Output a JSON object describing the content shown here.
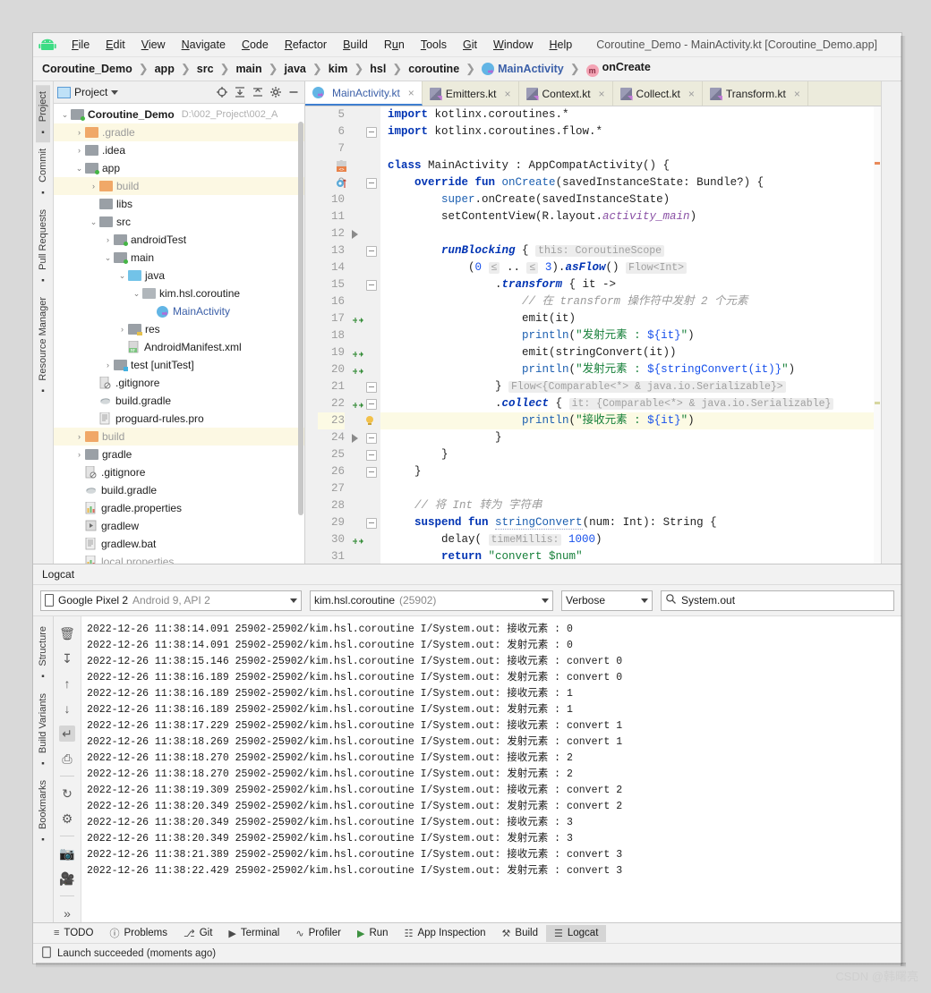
{
  "window": {
    "title": "Coroutine_Demo - MainActivity.kt [Coroutine_Demo.app]",
    "logo": "android-logo-icon"
  },
  "menubar": [
    {
      "label": "File",
      "accel": "F"
    },
    {
      "label": "Edit",
      "accel": "E"
    },
    {
      "label": "View",
      "accel": "V"
    },
    {
      "label": "Navigate",
      "accel": "N"
    },
    {
      "label": "Code",
      "accel": "C"
    },
    {
      "label": "Refactor",
      "accel": "R"
    },
    {
      "label": "Build",
      "accel": "B"
    },
    {
      "label": "Run",
      "accel": "u"
    },
    {
      "label": "Tools",
      "accel": "T"
    },
    {
      "label": "Git",
      "accel": "G"
    },
    {
      "label": "Window",
      "accel": "W"
    },
    {
      "label": "Help",
      "accel": "H"
    }
  ],
  "breadcrumb": [
    {
      "label": "Coroutine_Demo",
      "icon": ""
    },
    {
      "label": "app",
      "icon": ""
    },
    {
      "label": "src",
      "icon": ""
    },
    {
      "label": "main",
      "icon": ""
    },
    {
      "label": "java",
      "icon": ""
    },
    {
      "label": "kim",
      "icon": ""
    },
    {
      "label": "hsl",
      "icon": ""
    },
    {
      "label": "coroutine",
      "icon": ""
    },
    {
      "label": "MainActivity",
      "icon": "kotlin-class-icon"
    },
    {
      "label": "onCreate",
      "icon": "method-icon"
    }
  ],
  "left_strip": [
    {
      "label": "Project",
      "selected": true,
      "icon": "project-icon"
    },
    {
      "label": "Commit",
      "selected": false,
      "icon": "commit-icon"
    },
    {
      "label": "Pull Requests",
      "selected": false,
      "icon": "pull-request-icon"
    },
    {
      "label": "Resource Manager",
      "selected": false,
      "icon": "resource-icon"
    }
  ],
  "left_strip_bottom": [
    {
      "label": "Structure",
      "icon": "structure-icon"
    },
    {
      "label": "Build Variants",
      "icon": "build-variants-icon"
    },
    {
      "label": "Bookmarks",
      "icon": "bookmark-icon"
    }
  ],
  "project_panel": {
    "title": "Project",
    "project_name": "Coroutine_Demo",
    "project_path": "D:\\002_Project\\002_A",
    "toolbar_icons": [
      "target-icon",
      "collapse-icon",
      "expand-icon",
      "gear-icon",
      "minimize-icon"
    ],
    "tree": [
      {
        "depth": 0,
        "label": "Coroutine_Demo",
        "arrow": "down",
        "kind": "folder-grey-dot",
        "bold": true,
        "path": "D:\\002_Project\\002_A"
      },
      {
        "depth": 1,
        "label": ".gradle",
        "arrow": "right",
        "kind": "folder-orange",
        "highlight": true,
        "muted": true
      },
      {
        "depth": 1,
        "label": ".idea",
        "arrow": "right",
        "kind": "folder-grey"
      },
      {
        "depth": 1,
        "label": "app",
        "arrow": "down",
        "kind": "folder-grey-dot"
      },
      {
        "depth": 2,
        "label": "build",
        "arrow": "right",
        "kind": "folder-orange",
        "highlight": true,
        "muted": true
      },
      {
        "depth": 2,
        "label": "libs",
        "arrow": "none",
        "kind": "folder-grey"
      },
      {
        "depth": 2,
        "label": "src",
        "arrow": "down",
        "kind": "folder-grey"
      },
      {
        "depth": 3,
        "label": "androidTest",
        "arrow": "right",
        "kind": "folder-grey-dot"
      },
      {
        "depth": 3,
        "label": "main",
        "arrow": "down",
        "kind": "folder-grey-dot"
      },
      {
        "depth": 4,
        "label": "java",
        "arrow": "down",
        "kind": "folder-blue"
      },
      {
        "depth": 5,
        "label": "kim.hsl.coroutine",
        "arrow": "down",
        "kind": "package-icon"
      },
      {
        "depth": 6,
        "label": "MainActivity",
        "arrow": "none",
        "kind": "kotlin-class-icon",
        "link": true
      },
      {
        "depth": 4,
        "label": "res",
        "arrow": "right",
        "kind": "folder-res"
      },
      {
        "depth": 4,
        "label": "AndroidManifest.xml",
        "arrow": "none",
        "kind": "manifest-icon"
      },
      {
        "depth": 3,
        "label": "test [unitTest]",
        "arrow": "right",
        "kind": "folder-grey-sq"
      },
      {
        "depth": 2,
        "label": ".gitignore",
        "arrow": "none",
        "kind": "gitignore-icon"
      },
      {
        "depth": 2,
        "label": "build.gradle",
        "arrow": "none",
        "kind": "gradle-icon"
      },
      {
        "depth": 2,
        "label": "proguard-rules.pro",
        "arrow": "none",
        "kind": "text-file-icon"
      },
      {
        "depth": 1,
        "label": "build",
        "arrow": "right",
        "kind": "folder-orange",
        "highlight": true,
        "muted": true
      },
      {
        "depth": 1,
        "label": "gradle",
        "arrow": "right",
        "kind": "folder-grey"
      },
      {
        "depth": 1,
        "label": ".gitignore",
        "arrow": "none",
        "kind": "gitignore-icon"
      },
      {
        "depth": 1,
        "label": "build.gradle",
        "arrow": "none",
        "kind": "gradle-icon"
      },
      {
        "depth": 1,
        "label": "gradle.properties",
        "arrow": "none",
        "kind": "properties-icon"
      },
      {
        "depth": 1,
        "label": "gradlew",
        "arrow": "none",
        "kind": "script-icon"
      },
      {
        "depth": 1,
        "label": "gradlew.bat",
        "arrow": "none",
        "kind": "text-file-icon"
      },
      {
        "depth": 1,
        "label": "local.properties",
        "arrow": "none",
        "kind": "properties-icon",
        "muted": true
      }
    ]
  },
  "editor": {
    "tabs": [
      {
        "label": "MainActivity.kt",
        "active": true,
        "icon": "kotlin-class-icon"
      },
      {
        "label": "Emitters.kt",
        "active": false,
        "icon": "kotlin-file-icon"
      },
      {
        "label": "Context.kt",
        "active": false,
        "icon": "kotlin-file-icon"
      },
      {
        "label": "Collect.kt",
        "active": false,
        "icon": "kotlin-file-icon"
      },
      {
        "label": "Transform.kt",
        "active": false,
        "icon": "kotlin-file-icon"
      }
    ],
    "first_line": 5,
    "current_line": 23,
    "lines": [
      {
        "n": 5,
        "html": "<span class='kw'>import</span> kotlinx.coroutines.*"
      },
      {
        "n": 6,
        "html": "<span class='kw'>import</span> kotlinx.coroutines.flow.*"
      },
      {
        "n": 7,
        "html": ""
      },
      {
        "n": 8,
        "html": "<span class='kw'>class</span> MainActivity : AppCompatActivity() {"
      },
      {
        "n": 9,
        "html": "    <span class='kw'>override fun</span> <span class='fn'>onCreate</span>(savedInstanceState: Bundle?) {"
      },
      {
        "n": 10,
        "html": "        <span class='fn'>super</span>.onCreate(savedInstanceState)"
      },
      {
        "n": 11,
        "html": "        setContentView(R.layout.<span class='prop'>activity_main</span>)"
      },
      {
        "n": 12,
        "html": ""
      },
      {
        "n": 13,
        "html": "        <span class='kwi'>runBlocking</span> { <span class='hint'>this: CoroutineScope</span>"
      },
      {
        "n": 14,
        "html": "            (<span class='num'>0</span> <span class='hint'>≤</span> .. <span class='hint'>≤</span> <span class='num'>3</span>).<span class='kwi'>asFlow</span>() <span class='hint'>Flow&lt;Int&gt;</span>"
      },
      {
        "n": 15,
        "html": "                .<span class='kwi'>transform</span> { it -&gt;"
      },
      {
        "n": 16,
        "html": "                    <span class='cmt'>// 在 transform 操作符中发射 2 个元素</span>"
      },
      {
        "n": 17,
        "html": "                    emit(it)"
      },
      {
        "n": 18,
        "html": "                    <span class='fn'>println</span>(<span class='str'>\"发射元素 : </span><span class='tmpl'>${it}</span><span class='str'>\"</span>)"
      },
      {
        "n": 19,
        "html": "                    emit(stringConvert(it))"
      },
      {
        "n": 20,
        "html": "                    <span class='fn'>println</span>(<span class='str'>\"发射元素 : </span><span class='tmpl'>${stringConvert(it)}</span><span class='str'>\"</span>)"
      },
      {
        "n": 21,
        "html": "                } <span class='hint'>Flow&lt;{Comparable&lt;*&gt; &amp; java.io.Serializable}&gt;</span>"
      },
      {
        "n": 22,
        "html": "                .<span class='kwi'>collect</span> { <span class='hint'>it: {Comparable&lt;*&gt; &amp; java.io.Serializable}</span>"
      },
      {
        "n": 23,
        "html": "                    <span class='fn'>println</span>(<span class='str'>\"接收元素 : </span><span class='tmpl'>${it}</span><span class='str'>\"</span>)"
      },
      {
        "n": 24,
        "html": "                }"
      },
      {
        "n": 25,
        "html": "        }"
      },
      {
        "n": 26,
        "html": "    }"
      },
      {
        "n": 27,
        "html": ""
      },
      {
        "n": 28,
        "html": "    <span class='cmt'>// 将 Int 转为 字符串</span>"
      },
      {
        "n": 29,
        "html": "    <span class='kw'>suspend fun</span> <span class='fn wav'>stringConvert</span>(num: Int): String {"
      },
      {
        "n": 30,
        "html": "        delay( <span class='hint'>timeMillis:</span> <span class='num'>1000</span>)"
      },
      {
        "n": 31,
        "html": "        <span class='kw'>return</span> <span class='str'>\"convert $num\"</span>"
      },
      {
        "n": 32,
        "html": "    }"
      },
      {
        "n": 33,
        "html": "}"
      }
    ]
  },
  "logcat": {
    "title": "Logcat",
    "device": "Google Pixel 2",
    "device_detail": "Android 9, API 2",
    "process": "kim.hsl.coroutine",
    "process_pid": "(25902)",
    "level": "Verbose",
    "search_value": "System.out",
    "search_icon": "search-icon",
    "side_icons": [
      {
        "name": "trash-icon",
        "glyph": "🗑",
        "selected": false
      },
      {
        "name": "scroll-to-end-icon",
        "glyph": "↧",
        "selected": false
      },
      {
        "name": "up-arrow-icon",
        "glyph": "↑",
        "selected": false
      },
      {
        "name": "down-arrow-icon",
        "glyph": "↓",
        "selected": false
      },
      {
        "name": "soft-wrap-icon",
        "glyph": "↵",
        "selected": true
      },
      {
        "name": "print-icon",
        "glyph": "⎙",
        "selected": false
      },
      {
        "name": "restart-icon",
        "glyph": "↻",
        "selected": false
      },
      {
        "name": "gear-icon",
        "glyph": "⚙",
        "selected": false
      },
      {
        "name": "screenshot-icon",
        "glyph": "📷",
        "selected": false
      },
      {
        "name": "record-video-icon",
        "glyph": "🎥",
        "selected": false
      },
      {
        "name": "more-icon",
        "glyph": "»",
        "selected": false
      }
    ],
    "lines": [
      "2022-12-26 11:38:14.091 25902-25902/kim.hsl.coroutine I/System.out: 接收元素 : 0",
      "2022-12-26 11:38:14.091 25902-25902/kim.hsl.coroutine I/System.out: 发射元素 : 0",
      "2022-12-26 11:38:15.146 25902-25902/kim.hsl.coroutine I/System.out: 接收元素 : convert 0",
      "2022-12-26 11:38:16.189 25902-25902/kim.hsl.coroutine I/System.out: 发射元素 : convert 0",
      "2022-12-26 11:38:16.189 25902-25902/kim.hsl.coroutine I/System.out: 接收元素 : 1",
      "2022-12-26 11:38:16.189 25902-25902/kim.hsl.coroutine I/System.out: 发射元素 : 1",
      "2022-12-26 11:38:17.229 25902-25902/kim.hsl.coroutine I/System.out: 接收元素 : convert 1",
      "2022-12-26 11:38:18.269 25902-25902/kim.hsl.coroutine I/System.out: 发射元素 : convert 1",
      "2022-12-26 11:38:18.270 25902-25902/kim.hsl.coroutine I/System.out: 接收元素 : 2",
      "2022-12-26 11:38:18.270 25902-25902/kim.hsl.coroutine I/System.out: 发射元素 : 2",
      "2022-12-26 11:38:19.309 25902-25902/kim.hsl.coroutine I/System.out: 接收元素 : convert 2",
      "2022-12-26 11:38:20.349 25902-25902/kim.hsl.coroutine I/System.out: 发射元素 : convert 2",
      "2022-12-26 11:38:20.349 25902-25902/kim.hsl.coroutine I/System.out: 接收元素 : 3",
      "2022-12-26 11:38:20.349 25902-25902/kim.hsl.coroutine I/System.out: 发射元素 : 3",
      "2022-12-26 11:38:21.389 25902-25902/kim.hsl.coroutine I/System.out: 接收元素 : convert 3",
      "2022-12-26 11:38:22.429 25902-25902/kim.hsl.coroutine I/System.out: 发射元素 : convert 3"
    ]
  },
  "bottom_tabs": [
    {
      "label": "TODO",
      "icon": "todo-icon",
      "selected": false
    },
    {
      "label": "Problems",
      "icon": "problems-icon",
      "selected": false
    },
    {
      "label": "Git",
      "icon": "git-icon",
      "selected": false
    },
    {
      "label": "Terminal",
      "icon": "terminal-icon",
      "selected": false
    },
    {
      "label": "Profiler",
      "icon": "profiler-icon",
      "selected": false
    },
    {
      "label": "Run",
      "icon": "run-icon",
      "selected": false
    },
    {
      "label": "App Inspection",
      "icon": "app-inspection-icon",
      "selected": false
    },
    {
      "label": "Build",
      "icon": "build-icon",
      "selected": false
    },
    {
      "label": "Logcat",
      "icon": "logcat-icon",
      "selected": true
    }
  ],
  "statusbar": {
    "icon": "device-icon",
    "text": "Launch succeeded (moments ago)"
  },
  "watermark": "CSDN @韩曙亮",
  "colors": {
    "accent": "#3b5fa8",
    "tab_strip": "#ecebdc",
    "highlight_row": "#fcf8e3",
    "current_line": "#fcfae4",
    "keyword": "#0033b3",
    "string": "#17803a",
    "comment": "#9a9a9a"
  }
}
